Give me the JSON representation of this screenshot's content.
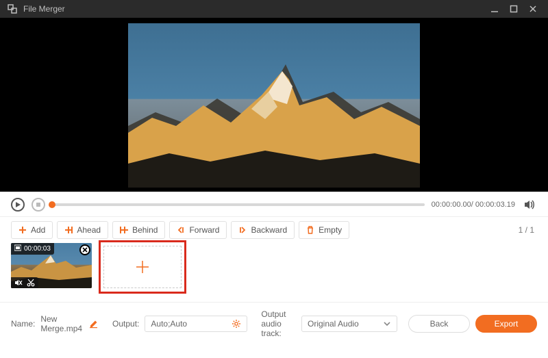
{
  "titlebar": {
    "title": "File Merger"
  },
  "playback": {
    "current": "00:00:00.00",
    "total": "00:00:03.19"
  },
  "toolbar": {
    "add": "Add",
    "ahead": "Ahead",
    "behind": "Behind",
    "forward": "Forward",
    "backward": "Backward",
    "empty": "Empty",
    "page": "1 / 1"
  },
  "clip": {
    "duration": "00:00:03"
  },
  "bottom": {
    "name_label": "Name:",
    "name_value": "New Merge.mp4",
    "output_label": "Output:",
    "output_value": "Auto;Auto",
    "audio_label": "Output audio track:",
    "audio_value": "Original Audio",
    "back": "Back",
    "export": "Export"
  }
}
